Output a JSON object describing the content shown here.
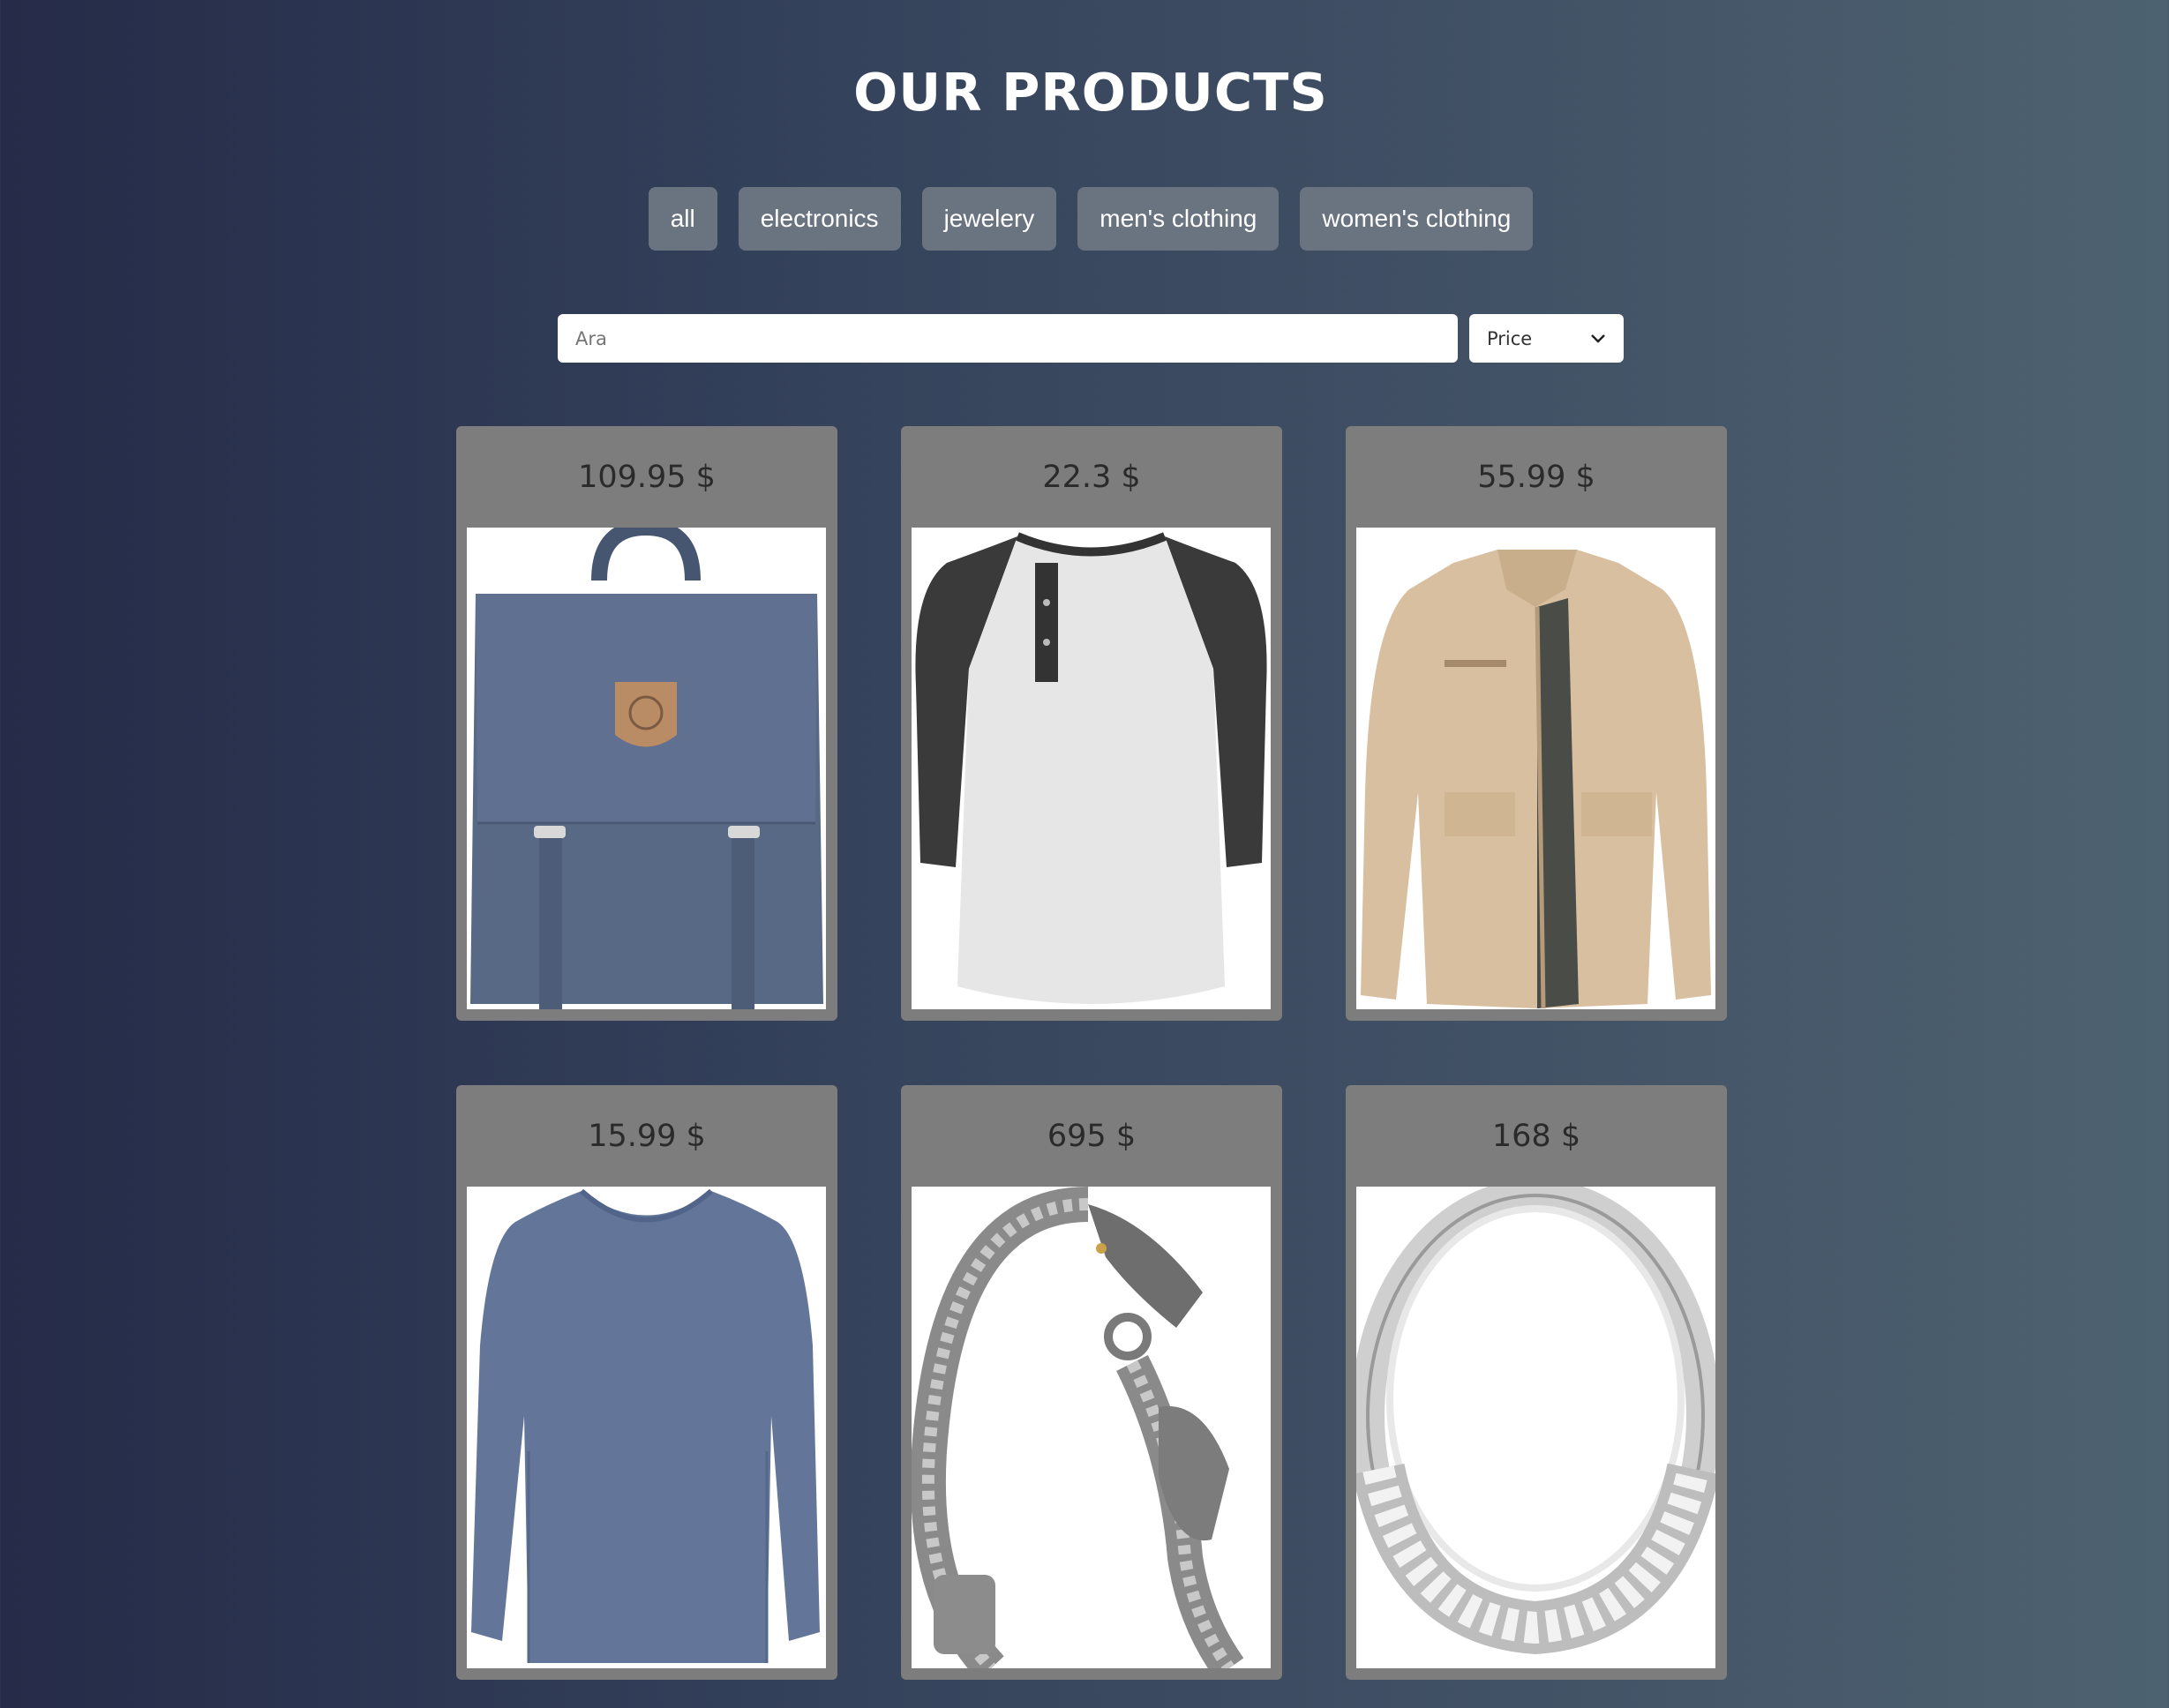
{
  "page": {
    "title": "OUR PRODUCTS"
  },
  "filters": [
    "all",
    "electronics",
    "jewelery",
    "men's clothing",
    "women's clothing"
  ],
  "search": {
    "placeholder": "Ara",
    "value": ""
  },
  "sort": {
    "selected": "Price"
  },
  "products": [
    {
      "price": "109.95 $",
      "image": "backpack"
    },
    {
      "price": "22.3 $",
      "image": "raglan-tshirt"
    },
    {
      "price": "55.99 $",
      "image": "jacket"
    },
    {
      "price": "15.99 $",
      "image": "longsleeve-tshirt"
    },
    {
      "price": "695 $",
      "image": "dragon-bracelet"
    },
    {
      "price": "168 $",
      "image": "ring"
    }
  ],
  "colors": {
    "button": "#6a7481",
    "card": "#7d7d7d",
    "text": "#ffffff"
  }
}
